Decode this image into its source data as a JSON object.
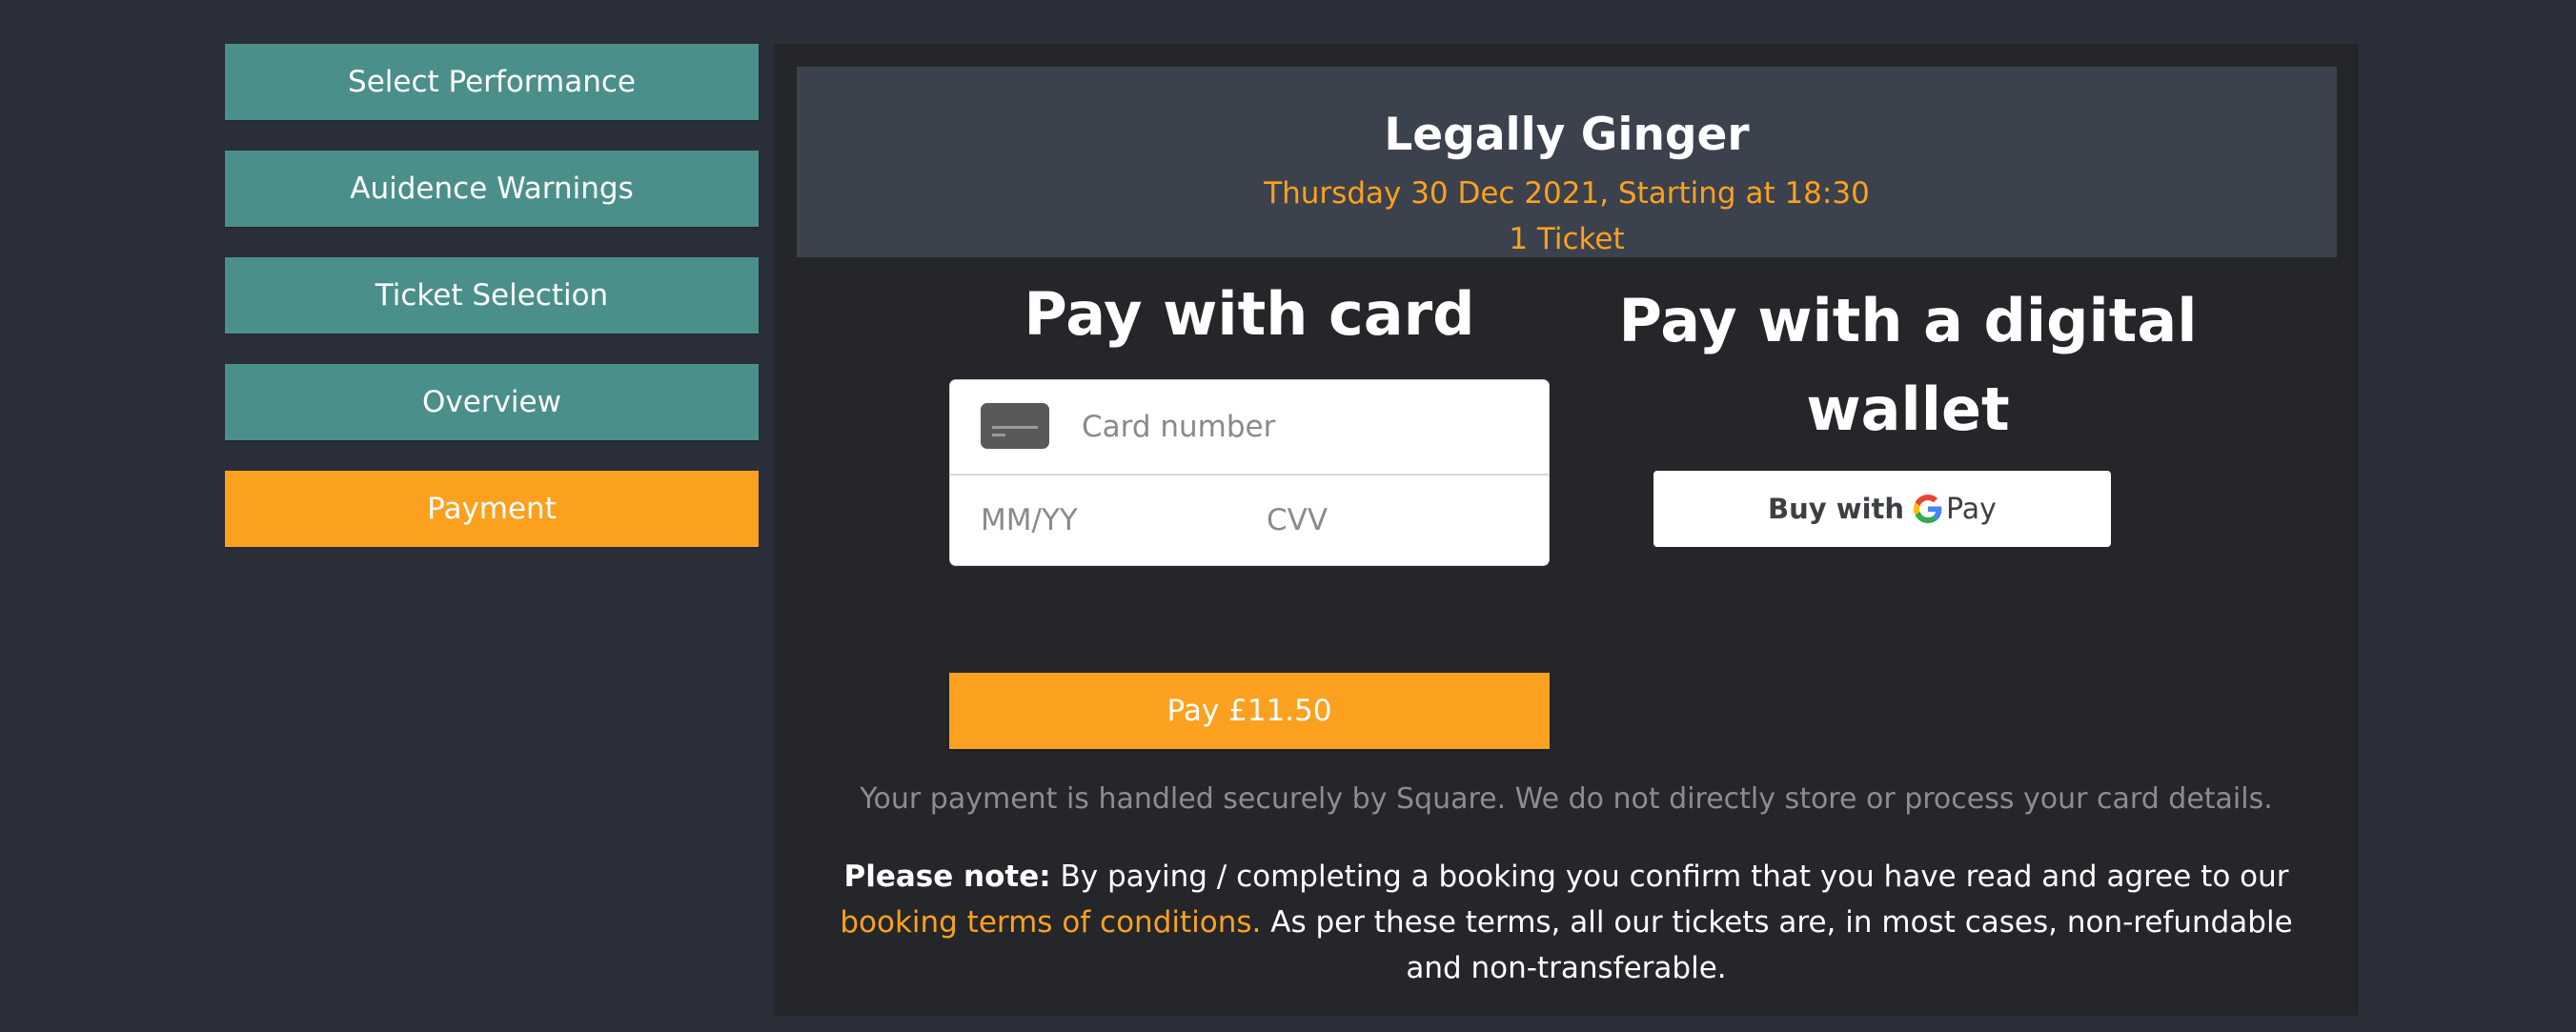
{
  "sidebar": {
    "steps": [
      {
        "label": "Select Performance"
      },
      {
        "label": "Auidence Warnings"
      },
      {
        "label": "Ticket Selection"
      },
      {
        "label": "Overview"
      },
      {
        "label": "Payment",
        "active": true
      }
    ]
  },
  "event": {
    "title": "Legally Ginger",
    "datetime": "Thursday 30 Dec 2021, Starting at 18:30",
    "tickets": "1 Ticket"
  },
  "card_payment": {
    "heading": "Pay with card",
    "card_number_placeholder": "Card number",
    "expiry_placeholder": "MM/YY",
    "cvv_placeholder": "CVV",
    "pay_button_label": "Pay £11.50"
  },
  "wallet_payment": {
    "heading_line1": "Pay with a digital",
    "heading_line2": "wallet",
    "gpay_buy_text": "Buy with",
    "gpay_pay_text": "Pay"
  },
  "notes": {
    "secure": "Your payment is handled securely by Square. We do not directly store or process your card details.",
    "terms_bold": "Please note:",
    "terms_text_1": "By paying / completing a booking you confirm that you have read and agree to our",
    "terms_link": "booking terms of conditions.",
    "terms_text_2": "As per these terms, all our tickets are, in most cases, non-refundable and non-transferable."
  },
  "colors": {
    "background": "#2b2f3a",
    "panel": "#242629",
    "banner": "#3c424d",
    "step_teal": "#4b8f8a",
    "accent_orange": "#fba11f"
  },
  "icons": {
    "card": "credit-card-icon",
    "google": "google-g-icon"
  }
}
